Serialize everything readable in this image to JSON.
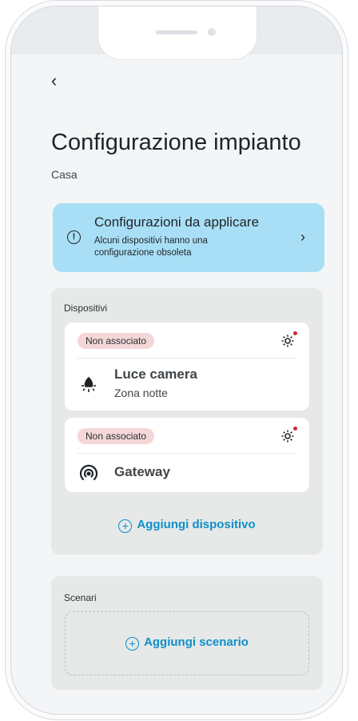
{
  "header": {
    "back_label": "‹",
    "title": "Configurazione impianto",
    "subtitle": "Casa"
  },
  "banner": {
    "icon": "info-icon",
    "title": "Configurazioni da applicare",
    "text": "Alcuni dispositivi hanno una configurazione obsoleta",
    "chevron": "›",
    "color": "#a9dff6"
  },
  "devices": {
    "label": "Dispositivi",
    "items": [
      {
        "badge": "Non associato",
        "name": "Luce camera",
        "zone": "Zona notte",
        "icon": "light-bulb-icon"
      },
      {
        "badge": "Non associato",
        "name": "Gateway",
        "zone": "",
        "icon": "gateway-icon"
      }
    ],
    "add_label": "Aggiungi dispositivo"
  },
  "scenarios": {
    "label": "Scenari",
    "add_label": "Aggiungi scenario"
  },
  "colors": {
    "accent": "#0f8ec8",
    "badge_bg": "#f5d7d8",
    "alert_dot": "#d1283a"
  }
}
